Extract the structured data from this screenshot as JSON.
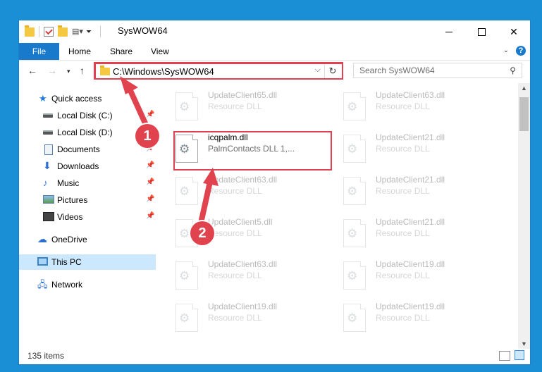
{
  "window": {
    "title": "SysWOW64",
    "controls": {
      "minimize": "minimize",
      "maximize": "maximize",
      "close": "✕"
    }
  },
  "ribbon": {
    "tabs": [
      "File",
      "Home",
      "Share",
      "View"
    ],
    "help": "?"
  },
  "navigation": {
    "back": "←",
    "forward": "→",
    "recent": "▾",
    "up": "↑"
  },
  "address_bar": {
    "path": "C:\\Windows\\SysWOW64",
    "dropdown": "⌵",
    "refresh": "↻"
  },
  "search": {
    "placeholder": "Search SysWOW64",
    "icon": "search-icon"
  },
  "sidebar": {
    "items": [
      {
        "label": "Quick access",
        "icon": "star-icon",
        "pinned": false
      },
      {
        "label": "Local Disk (C:)",
        "icon": "disk-icon",
        "pinned": true
      },
      {
        "label": "Local Disk (D:)",
        "icon": "disk-icon",
        "pinned": true
      },
      {
        "label": "Documents",
        "icon": "documents-icon",
        "pinned": true
      },
      {
        "label": "Downloads",
        "icon": "download-icon",
        "pinned": true
      },
      {
        "label": "Music",
        "icon": "music-icon",
        "pinned": true
      },
      {
        "label": "Pictures",
        "icon": "pictures-icon",
        "pinned": true
      },
      {
        "label": "Videos",
        "icon": "videos-icon",
        "pinned": true
      },
      {
        "label": "OneDrive",
        "icon": "cloud-icon",
        "pinned": false
      },
      {
        "label": "This PC",
        "icon": "pc-icon",
        "pinned": false,
        "selected": true
      },
      {
        "label": "Network",
        "icon": "network-icon",
        "pinned": false
      }
    ],
    "pin_glyph": "📌"
  },
  "files": [
    {
      "name": "UpdateClient65.dll",
      "desc": "Resource DLL",
      "faded": true
    },
    {
      "name": "UpdateClient63.dll",
      "desc": "Resource DLL",
      "faded": true
    },
    {
      "name": "icqpalm.dll",
      "desc": "PalmContacts DLL 1,...",
      "faded": false,
      "highlighted": true
    },
    {
      "name": "UpdateClient21.dll",
      "desc": "Resource DLL",
      "faded": true
    },
    {
      "name": "UpdateClient63.dll",
      "desc": "Resource DLL",
      "faded": true
    },
    {
      "name": "UpdateClient21.dll",
      "desc": "Resource DLL",
      "faded": true
    },
    {
      "name": "UpdateClient5.dll",
      "desc": "Resource DLL",
      "faded": true
    },
    {
      "name": "UpdateClient21.dll",
      "desc": "Resource DLL",
      "faded": true
    },
    {
      "name": "UpdateClient63.dll",
      "desc": "Resource DLL",
      "faded": true
    },
    {
      "name": "UpdateClient19.dll",
      "desc": "Resource DLL",
      "faded": true
    },
    {
      "name": "UpdateClient19.dll",
      "desc": "Resource DLL",
      "faded": true
    },
    {
      "name": "UpdateClient19.dll",
      "desc": "Resource DLL",
      "faded": true
    }
  ],
  "status": {
    "item_count": "135 items"
  },
  "callouts": [
    {
      "number": "1"
    },
    {
      "number": "2"
    }
  ],
  "colors": {
    "accent": "#1979ca",
    "callout_red": "#e0424e",
    "selection": "#cce8ff"
  }
}
